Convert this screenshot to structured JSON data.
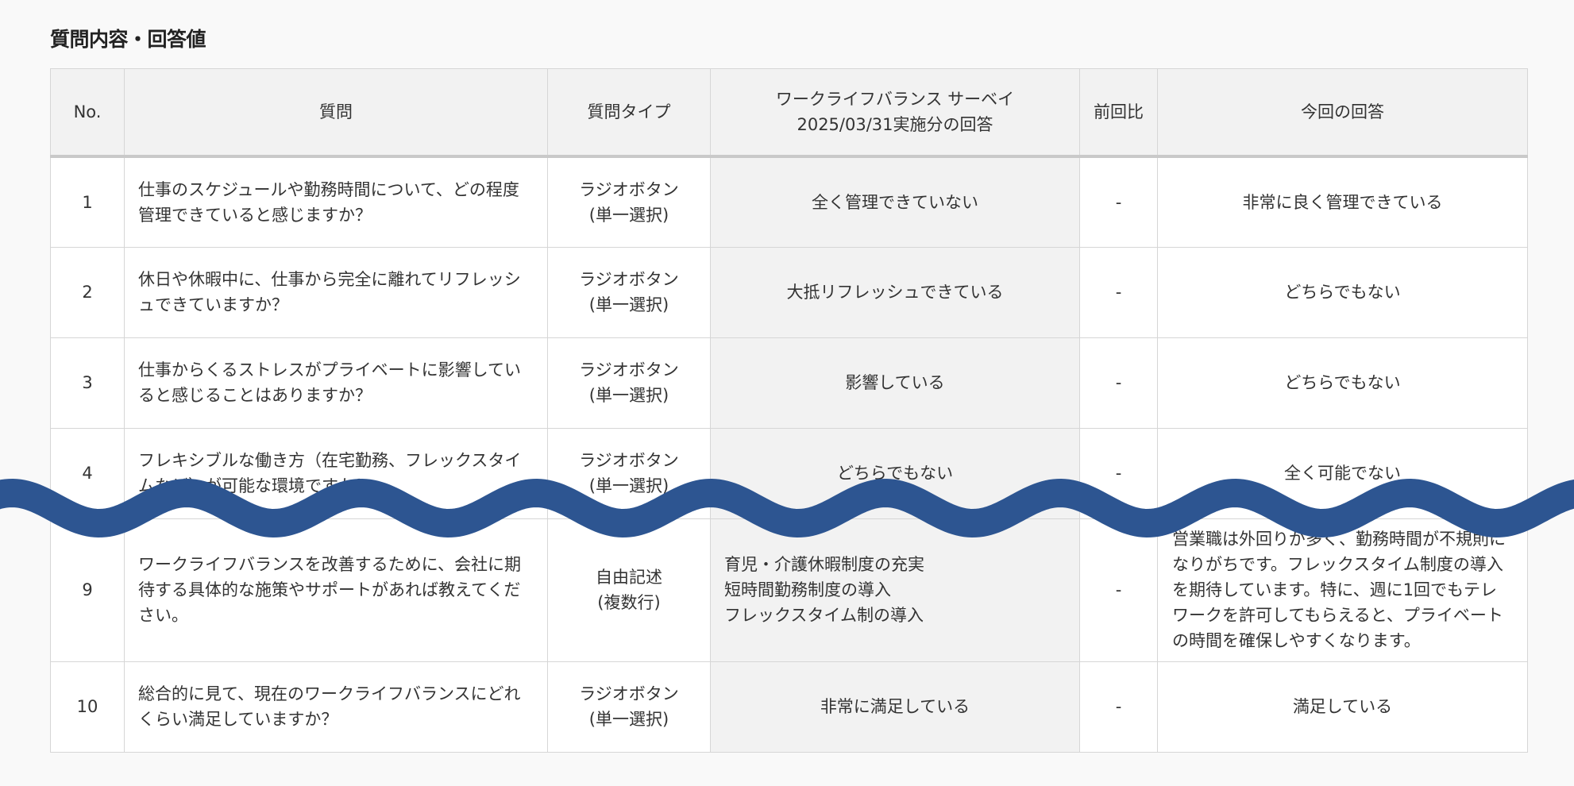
{
  "section_title": "質問内容・回答値",
  "headers": {
    "no": "No.",
    "question": "質問",
    "type": "質問タイプ",
    "prev_title": "ワークライフバランス サーベイ\n2025/03/31実施分の回答",
    "diff": "前回比",
    "current": "今回の回答"
  },
  "rows": [
    {
      "no": "1",
      "question": "仕事のスケジュールや勤務時間について、どの程度管理できていると感じますか？",
      "type": "ラジオボタン\n(単一選択)",
      "prev": "全く管理できていない",
      "diff": "-",
      "current": "非常に良く管理できている"
    },
    {
      "no": "2",
      "question": "休日や休暇中に、仕事から完全に離れてリフレッシュできていますか？",
      "type": "ラジオボタン\n(単一選択)",
      "prev": "大抵リフレッシュできている",
      "diff": "-",
      "current": "どちらでもない"
    },
    {
      "no": "3",
      "question": "仕事からくるストレスがプライベートに影響していると感じることはありますか？",
      "type": "ラジオボタン\n(単一選択)",
      "prev": "影響している",
      "diff": "-",
      "current": "どちらでもない"
    },
    {
      "no": "4",
      "question": "フレキシブルな働き方（在宅勤務、フレックスタイムなど）が可能な環境ですか？",
      "type": "ラジオボタン\n(単一選択)",
      "prev": "どちらでもない",
      "diff": "-",
      "current": "全く可能でない"
    },
    {
      "no": "9",
      "question": "ワークライフバランスを改善するために、会社に期待する具体的な施策やサポートがあれば教えてください。",
      "type": "自由記述\n(複数行)",
      "prev": "育児・介護休暇制度の充実\n短時間勤務制度の導入\nフレックスタイム制の導入",
      "diff": "-",
      "current": "営業職は外回りが多く、勤務時間が不規則になりがちです。フレックスタイム制度の導入を期待しています。特に、週に1回でもテレワークを許可してもらえると、プライベートの時間を確保しやすくなります。"
    },
    {
      "no": "10",
      "question": "総合的に見て、現在のワークライフバランスにどれくらい満足していますか？",
      "type": "ラジオボタン\n(単一選択)",
      "prev": "非常に満足している",
      "diff": "-",
      "current": "満足している"
    }
  ],
  "colors": {
    "wave": "#2d5591",
    "header_bg": "#f2f2f2",
    "border": "#d6d6d6"
  }
}
